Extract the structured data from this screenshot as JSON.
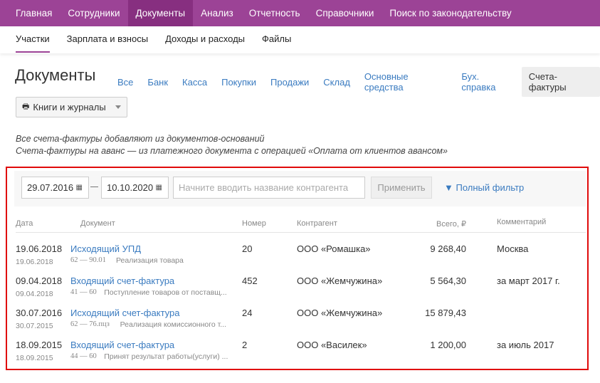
{
  "topnav": [
    "Главная",
    "Сотрудники",
    "Документы",
    "Анализ",
    "Отчетность",
    "Справочники",
    "Поиск по законодательству"
  ],
  "subnav": [
    "Участки",
    "Зарплата и взносы",
    "Доходы и расходы",
    "Файлы"
  ],
  "title": "Документы",
  "doctabs": [
    "Все",
    "Банк",
    "Касса",
    "Покупки",
    "Продажи",
    "Склад",
    "Основные средства",
    "Бух. справка",
    "Счета-фактуры"
  ],
  "books_label": "Книги и журналы",
  "notes": [
    "Все счета-фактуры добавляют из документов-оснований",
    "Счета-фактуры на аванс — из платежного документа с операцией «Оплата от клиентов авансом»"
  ],
  "filter": {
    "date_from": "29.07.2016",
    "date_to": "10.10.2020",
    "placeholder": "Начните вводить название контрагента",
    "apply": "Применить",
    "full_filter": "Полный фильтр"
  },
  "columns": [
    "Дата",
    "Документ",
    "Номер",
    "Контрагент",
    "Всего, ₽",
    "Комментарий"
  ],
  "rows": [
    {
      "date": "19.06.2018",
      "date2": "19.06.2018",
      "doc": "Исходящий УПД",
      "accounts": "62 — 90.01",
      "desc": "Реализация товара",
      "number": "20",
      "contractor": "ООО «Ромашка»",
      "total": "9 268,40",
      "comment": "Москва"
    },
    {
      "date": "09.04.2018",
      "date2": "09.04.2018",
      "doc": "Входящий счет-фактура",
      "accounts": "41 — 60",
      "desc": "Поступление товаров от поставщ...",
      "number": "452",
      "contractor": "ООО «Жемчужина»",
      "total": "5 564,30",
      "comment": "за март 2017 г."
    },
    {
      "date": "30.07.2016",
      "date2": "30.07.2015",
      "doc": "Исходящий счет-фактура",
      "accounts": "62 — 76.пцз",
      "desc": "Реализация комиссионного т...",
      "number": "24",
      "contractor": "ООО «Жемчужина»",
      "total": "15 879,43",
      "comment": ""
    },
    {
      "date": "18.09.2015",
      "date2": "18.09.2015",
      "doc": "Входящий счет-фактура",
      "accounts": "44 — 60",
      "desc": "Принят результат работы(услуги) ...",
      "number": "2",
      "contractor": "ООО «Василек»",
      "total": "1 200,00",
      "comment": "за июль 2017"
    }
  ]
}
